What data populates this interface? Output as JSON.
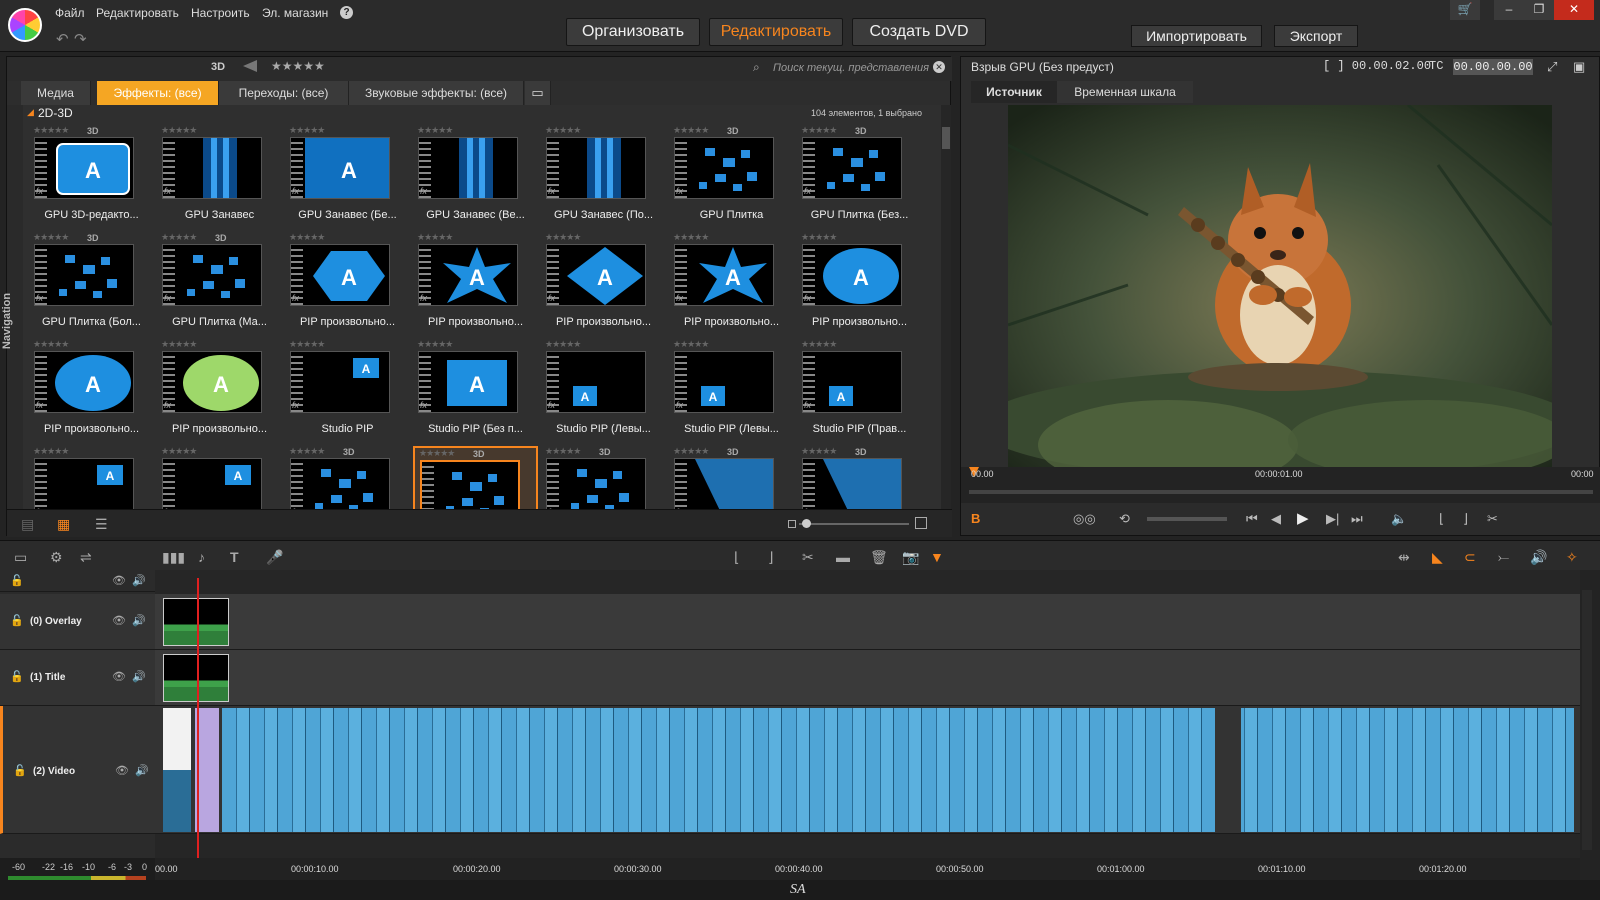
{
  "menu": {
    "file": "Файл",
    "edit": "Редактировать",
    "setup": "Настроить",
    "store": "Эл. магазин",
    "help": "?"
  },
  "modes": {
    "organize": "Организовать",
    "edit": "Редактировать",
    "dvd": "Создать DVD"
  },
  "actions": {
    "import": "Импортировать",
    "export": "Экспорт"
  },
  "library": {
    "filter_3d": "3D",
    "filter_rating": "★★★★★",
    "search_placeholder": "Поиск текущ. представления",
    "tabs": [
      {
        "label": "Медиа"
      },
      {
        "label": "Эффекты: (все)"
      },
      {
        "label": "Переходы: (все)"
      },
      {
        "label": "Звуковые эффекты: (все)"
      }
    ],
    "nav_label": "Navigation",
    "group": "2D-3D",
    "count": "104 элементов, 1 выбрано",
    "items": [
      {
        "label": "GPU 3D-редакто...",
        "d3": "3D"
      },
      {
        "label": "GPU Занавес",
        "d3": ""
      },
      {
        "label": "GPU Занавес (Бе...",
        "d3": ""
      },
      {
        "label": "GPU Занавес (Ве...",
        "d3": ""
      },
      {
        "label": "GPU Занавес (По...",
        "d3": ""
      },
      {
        "label": "GPU Плитка",
        "d3": "3D"
      },
      {
        "label": "GPU Плитка (Без...",
        "d3": "3D"
      },
      {
        "label": "GPU Плитка (Бол...",
        "d3": "3D"
      },
      {
        "label": "GPU Плитка (Ма...",
        "d3": "3D"
      },
      {
        "label": "PIP произвольно...",
        "d3": ""
      },
      {
        "label": "PIP произвольно...",
        "d3": ""
      },
      {
        "label": "PIP произвольно...",
        "d3": ""
      },
      {
        "label": "PIP произвольно...",
        "d3": ""
      },
      {
        "label": "PIP произвольно...",
        "d3": ""
      },
      {
        "label": "PIP произвольно...",
        "d3": ""
      },
      {
        "label": "PIP произвольно...",
        "d3": ""
      },
      {
        "label": "Studio PIP",
        "d3": ""
      },
      {
        "label": "Studio PIP (Без п...",
        "d3": ""
      },
      {
        "label": "Studio PIP (Левы...",
        "d3": ""
      },
      {
        "label": "Studio PIP (Левы...",
        "d3": ""
      },
      {
        "label": "Studio PIP (Прав...",
        "d3": ""
      },
      {
        "label": "",
        "d3": ""
      },
      {
        "label": "",
        "d3": ""
      },
      {
        "label": "",
        "d3": "3D"
      },
      {
        "label": "",
        "d3": "3D"
      },
      {
        "label": "",
        "d3": "3D"
      },
      {
        "label": "",
        "d3": "3D"
      },
      {
        "label": "",
        "d3": "3D"
      }
    ]
  },
  "player": {
    "title": "Взрыв GPU (Без предуст)",
    "duration": "[ ] 00.00.02.00",
    "tc_label": "TC",
    "tc_value": "00.00.00.00",
    "tabs": [
      {
        "label": "Источник"
      },
      {
        "label": "Временная шкала"
      }
    ],
    "ruler": [
      "00.00",
      "00:00:01.00",
      "00:00"
    ],
    "marker_b": "B"
  },
  "timeline": {
    "tracks": [
      {
        "name": "(0) Overlay"
      },
      {
        "name": "(1) Title"
      },
      {
        "name": "(2) Video"
      }
    ],
    "ruler": [
      "00.00",
      "00:00:10.00",
      "00:00:20.00",
      "00:00:30.00",
      "00:00:40.00",
      "00:00:50.00",
      "00:01:00.00",
      "00:01:10.00",
      "00:01:20.00"
    ],
    "vu": [
      "-60",
      "-22",
      "-16",
      "-10",
      "-6",
      "-3",
      "0"
    ]
  },
  "watermark": "SA",
  "colors": {
    "accent": "#f7851e",
    "tab_active": "#f5a623",
    "clip_blue": "#4fa5d6",
    "playhead": "#e02020"
  }
}
